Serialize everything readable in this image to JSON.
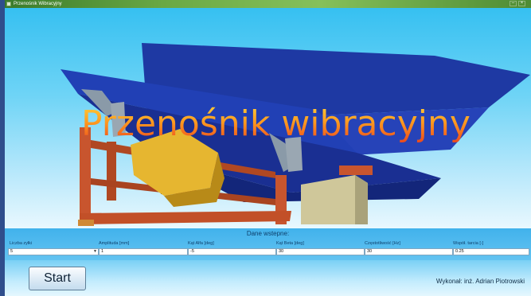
{
  "window": {
    "title": "Przenośnik Wibracyjny"
  },
  "banner": {
    "title": "Przenośnik wibracyjny"
  },
  "inputs": {
    "heading": "Dane wstepne:",
    "fields": [
      {
        "label": "Liczba zyłki",
        "value": "5"
      },
      {
        "label": "Amplituda [mm]",
        "value": "1"
      },
      {
        "label": "Kąt Alfa [deg]",
        "value": "-5"
      },
      {
        "label": "Kąt Beta [deg]",
        "value": "30"
      },
      {
        "label": "Częstotliwość [Hz]",
        "value": "30"
      },
      {
        "label": "Współ. tarcia [-]",
        "value": "0.25"
      }
    ]
  },
  "footer": {
    "start_label": "Start",
    "author": "Wykonał: inż. Adrian Piotrowski"
  },
  "colors": {
    "sky": "#36c0f1",
    "trough": "#1f3aa6",
    "frame": "#c8552e",
    "motor": "#e6b630",
    "cabinet": "#cfc79a"
  }
}
